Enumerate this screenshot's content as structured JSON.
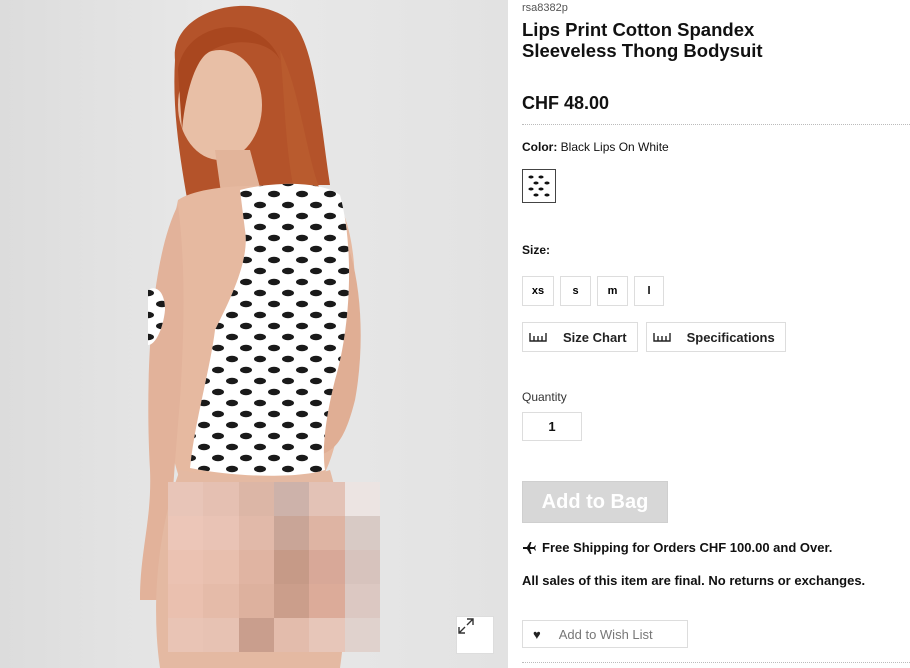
{
  "product": {
    "sku": "rsa8382p",
    "title": "Lips Print Cotton Spandex Sleeveless Thong Bodysuit",
    "price": "CHF 48.00"
  },
  "color": {
    "label": "Color:",
    "value": "Black Lips On White"
  },
  "size": {
    "label": "Size:",
    "options": [
      "xs",
      "s",
      "m",
      "l"
    ]
  },
  "info_buttons": {
    "size_chart": "Size Chart",
    "specifications": "Specifications"
  },
  "quantity": {
    "label": "Quantity",
    "value": "1"
  },
  "actions": {
    "add_to_bag": "Add to Bag",
    "add_to_wish_list": "Add to Wish List"
  },
  "notices": {
    "shipping": "Free Shipping for Orders CHF 100.00 and Over.",
    "final_sale": "All sales of this item are final. No returns or exchanges."
  },
  "icons": {
    "expand": "expand-icon",
    "ruler": "ruler-icon",
    "plane": "airplane-icon",
    "heart": "heart-icon"
  },
  "colors": {
    "button_disabled": "#d7d7d7",
    "text": "#111111",
    "border": "#dddddd"
  }
}
